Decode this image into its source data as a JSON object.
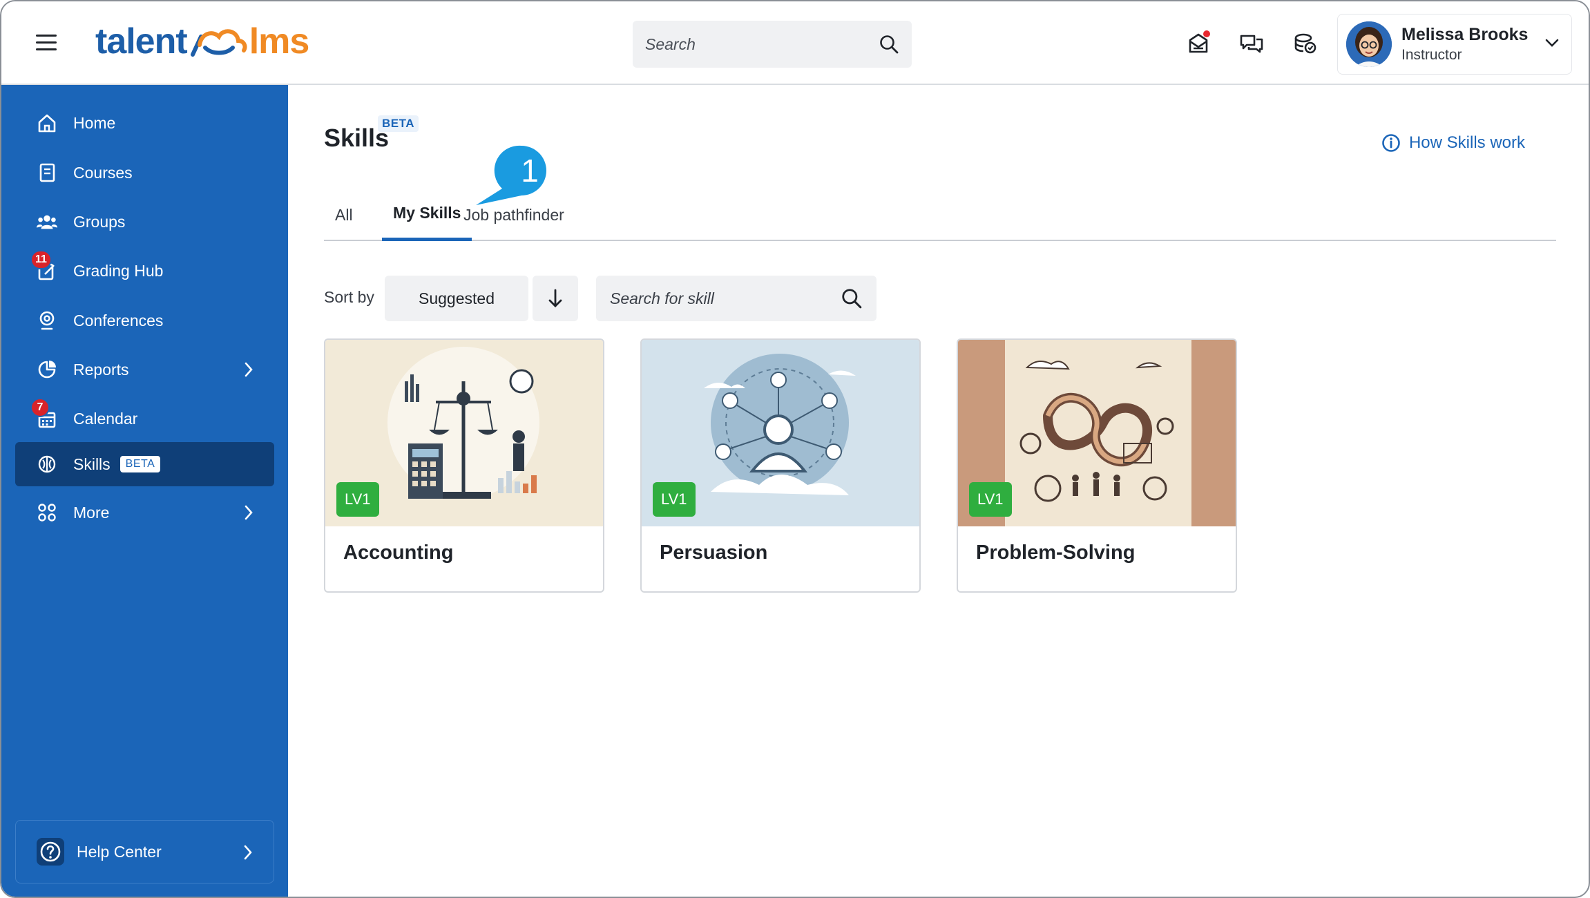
{
  "header": {
    "logo_left": "talent",
    "logo_right": "lms",
    "search_placeholder": "Search",
    "user": {
      "name": "Melissa Brooks",
      "role": "Instructor"
    }
  },
  "sidebar": {
    "items": [
      {
        "label": "Home",
        "icon": "home-icon"
      },
      {
        "label": "Courses",
        "icon": "book-icon"
      },
      {
        "label": "Groups",
        "icon": "users-icon"
      },
      {
        "label": "Grading Hub",
        "icon": "grading-icon",
        "badge": "11"
      },
      {
        "label": "Conferences",
        "icon": "webcam-icon"
      },
      {
        "label": "Reports",
        "icon": "pie-chart-icon"
      },
      {
        "label": "Calendar",
        "icon": "calendar-icon",
        "badge": "7"
      },
      {
        "label": "Skills",
        "icon": "brain-icon",
        "pill": "BETA",
        "active": true
      },
      {
        "label": "More",
        "icon": "grid-icon"
      }
    ],
    "help_label": "Help Center"
  },
  "main": {
    "title": "Skills",
    "title_badge": "BETA",
    "how_link": "How Skills work",
    "tabs": [
      {
        "label": "All"
      },
      {
        "label": "My Skills",
        "active": true
      },
      {
        "label": "Job pathfinder"
      }
    ],
    "callout_number": "1",
    "sort_label": "Sort by",
    "sort_value": "Suggested",
    "skill_search_placeholder": "Search for skill",
    "cards": [
      {
        "name": "Accounting",
        "level": "LV1"
      },
      {
        "name": "Persuasion",
        "level": "LV1"
      },
      {
        "name": "Problem-Solving",
        "level": "LV1"
      }
    ]
  },
  "colors": {
    "sidebar": "#1b65b8",
    "sidebar_active": "#0f3f78",
    "accent": "#1b65b8",
    "level_badge": "#2fae3f",
    "logo_orange": "#f08a24",
    "callout": "#1a9be0"
  }
}
